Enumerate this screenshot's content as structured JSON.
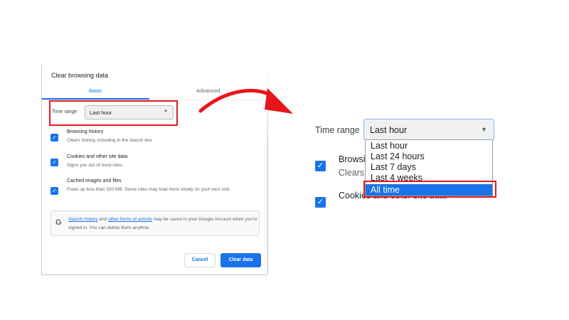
{
  "dialog": {
    "title": "Clear browsing data",
    "tabs": [
      {
        "label": "Basic",
        "active": true
      },
      {
        "label": "Advanced",
        "active": false
      }
    ],
    "time_range": {
      "label": "Time range",
      "value": "Last hour"
    },
    "options": [
      {
        "title": "Browsing history",
        "desc": "Clears history, including in the search box",
        "checked": true
      },
      {
        "title": "Cookies and other site data",
        "desc": "Signs you out of most sites.",
        "checked": true
      },
      {
        "title": "Cached images and files",
        "desc": "Frees up less than 320 MB. Some sites may load more slowly on your next visit.",
        "checked": true
      }
    ],
    "note": {
      "icon": "G",
      "link1": "Search history",
      "and": " and ",
      "link2": "other forms of activity",
      "rest": " may be saved in your Google Account when you're signed in. You can delete them anytime."
    },
    "cancel_label": "Cancel",
    "clear_label": "Clear data"
  },
  "zoom": {
    "time_range_label": "Time range",
    "selected_value": "Last hour",
    "dropdown_options": [
      "Last hour",
      "Last 24 hours",
      "Last 7 days",
      "Last 4 weeks",
      "All time"
    ],
    "highlighted_option": "All time",
    "partial_browsing": "Browsi",
    "partial_clears": "Clears",
    "partial_cookies": "Cookies and other site data"
  },
  "colors": {
    "accent": "#1a73e8",
    "highlight_box": "#e01b24",
    "arrow": "#e8141c"
  },
  "icons": {
    "caret": "triangle-down-icon",
    "check": "checkmark-icon",
    "google": "google-g-icon",
    "arrow": "curved-red-arrow-icon"
  }
}
